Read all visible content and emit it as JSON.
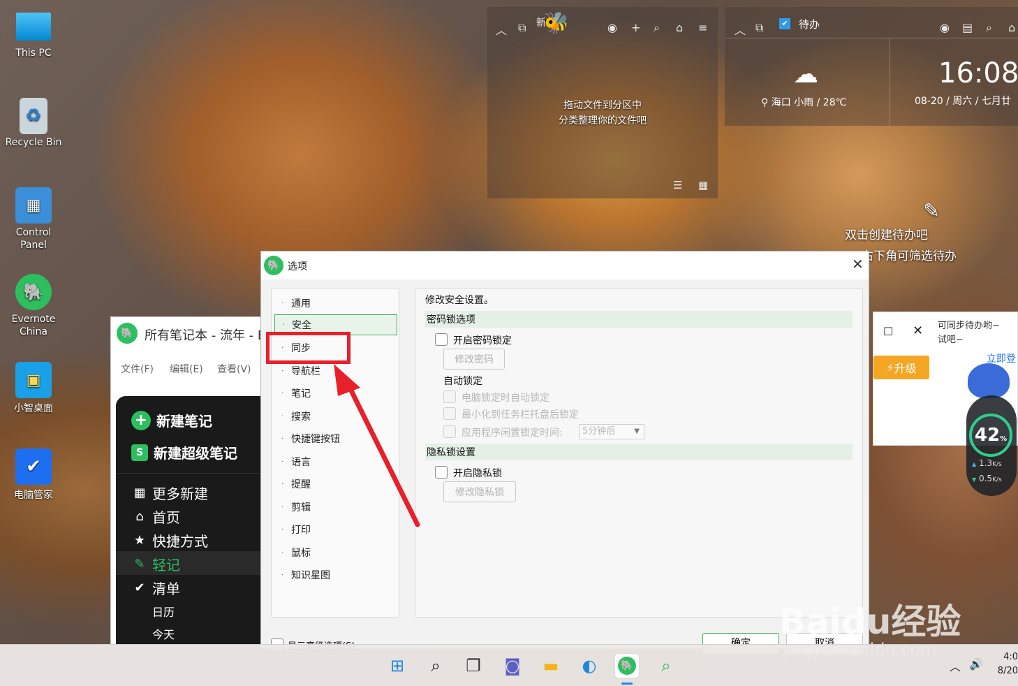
{
  "desktop": {
    "icons": [
      {
        "label": "This PC"
      },
      {
        "label": "Recycle Bin"
      },
      {
        "label": "Control Panel"
      },
      {
        "label": "Evernote China"
      },
      {
        "label": "小智桌面"
      },
      {
        "label": "电脑管家"
      }
    ]
  },
  "partition_widget": {
    "title": "新 区",
    "hint_line1": "拖动文件到分区中",
    "hint_line2": "分类整理你的文件吧"
  },
  "todo_widget": {
    "title": "待办",
    "weather": "海口 小雨 / 28℃",
    "time": "16:08",
    "date": "08-20 / 周六 / 七月廿",
    "empty_line1": "双击创建待办吧",
    "empty_line2": "右下角可筛选待办"
  },
  "promo_window": {
    "line1": "可同步待办哟~",
    "line2": "试吧~",
    "upgrade_label": "升级",
    "login_label": "立即登"
  },
  "net_monitor": {
    "percent": "42",
    "percent_unit": "%",
    "upload": "1.3",
    "download": "0.5",
    "speed_unit": "K/s"
  },
  "evernote": {
    "title": "所有笔记本 - 流年 - E",
    "menu": [
      "文件(F)",
      "编辑(E)",
      "查看(V)"
    ],
    "new_note": "新建笔记",
    "new_super_note": "新建超级笔记",
    "nav": [
      "更多新建",
      "首页",
      "快捷方式",
      "轻记",
      "清单",
      "日历",
      "今天"
    ]
  },
  "options_dialog": {
    "title": "选项",
    "nav_items": [
      "通用",
      "安全",
      "同步",
      "导航栏",
      "笔记",
      "搜索",
      "快捷键按钮",
      "语言",
      "提醒",
      "剪辑",
      "打印",
      "鼠标",
      "知识星图"
    ],
    "selected": "安全",
    "heading": "修改安全设置。",
    "password_section": "密码锁选项",
    "enable_password_lock": "开启密码锁定",
    "change_password": "修改密码",
    "auto_lock": "自动锁定",
    "lock_on_pc_lock": "电脑锁定时自动锁定",
    "lock_on_minimize": "最小化到任务栏托盘后锁定",
    "lock_on_idle": "应用程序闲置锁定时间:",
    "idle_value": "5分钟后",
    "privacy_section": "隐私锁设置",
    "enable_privacy_lock": "开启隐私锁",
    "change_privacy_lock": "修改隐私锁",
    "show_advanced": "显示高级选项(S)",
    "ok": "确定",
    "cancel": "取消"
  },
  "taskbar": {
    "clock_time": "4:0",
    "clock_date": "8/20"
  },
  "watermark": {
    "line1": "Baidu经验",
    "line2": "jingyan.baidu.com"
  },
  "colors": {
    "accent_green": "#3aa95a",
    "annotation_red": "#e8202a",
    "upgrade_orange": "#f5a623"
  }
}
